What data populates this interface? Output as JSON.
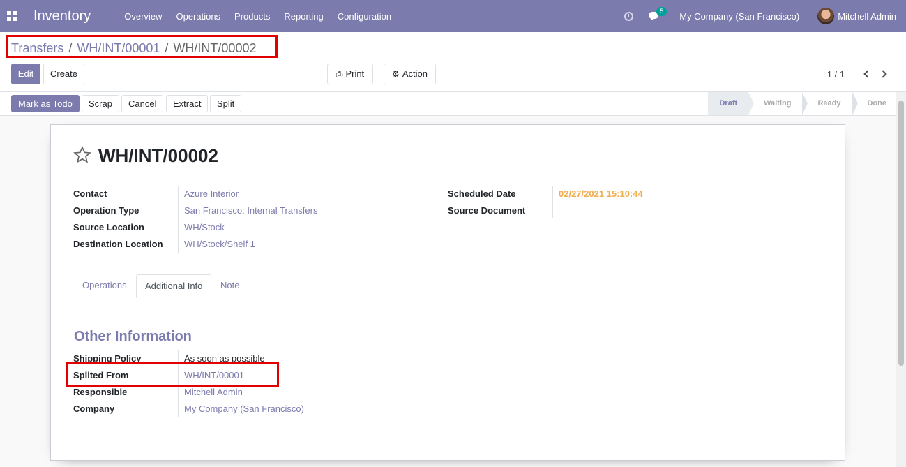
{
  "app": {
    "title": "Inventory"
  },
  "navbar": {
    "menu": [
      "Overview",
      "Operations",
      "Products",
      "Reporting",
      "Configuration"
    ],
    "messages_count": "5",
    "company": "My Company (San Francisco)",
    "user": "Mitchell Admin"
  },
  "breadcrumb": {
    "root": "Transfers",
    "parent": "WH/INT/00001",
    "current": "WH/INT/00002",
    "separator": "/"
  },
  "buttons": {
    "edit": "Edit",
    "create": "Create",
    "print": "Print",
    "action": "Action"
  },
  "pager": {
    "value": "1 / 1"
  },
  "status_buttons": [
    "Mark as Todo",
    "Scrap",
    "Cancel",
    "Extract",
    "Split"
  ],
  "stages": [
    {
      "label": "Draft",
      "current": true
    },
    {
      "label": "Waiting",
      "current": false
    },
    {
      "label": "Ready",
      "current": false
    },
    {
      "label": "Done",
      "current": false
    }
  ],
  "record": {
    "title": "WH/INT/00002",
    "fields_left": [
      {
        "label": "Contact",
        "value": "Azure Interior"
      },
      {
        "label": "Operation Type",
        "value": "San Francisco: Internal Transfers"
      },
      {
        "label": "Source Location",
        "value": "WH/Stock"
      },
      {
        "label": "Destination Location",
        "value": "WH/Stock/Shelf 1"
      }
    ],
    "fields_right": [
      {
        "label": "Scheduled Date",
        "value": "02/27/2021 15:10:44"
      },
      {
        "label": "Source Document",
        "value": ""
      }
    ]
  },
  "tabs": [
    {
      "label": "Operations",
      "active": false
    },
    {
      "label": "Additional Info",
      "active": true
    },
    {
      "label": "Note",
      "active": false
    }
  ],
  "other_info": {
    "title": "Other Information",
    "fields": [
      {
        "label": "Shipping Policy",
        "value": "As soon as possible"
      },
      {
        "label": "Splited From",
        "value": "WH/INT/00001"
      },
      {
        "label": "Responsible",
        "value": "Mitchell Admin"
      },
      {
        "label": "Company",
        "value": "My Company (San Francisco)"
      }
    ]
  },
  "colors": {
    "brand": "#7c7bad",
    "highlight": "#e10000",
    "date": "#f0ad4e"
  }
}
